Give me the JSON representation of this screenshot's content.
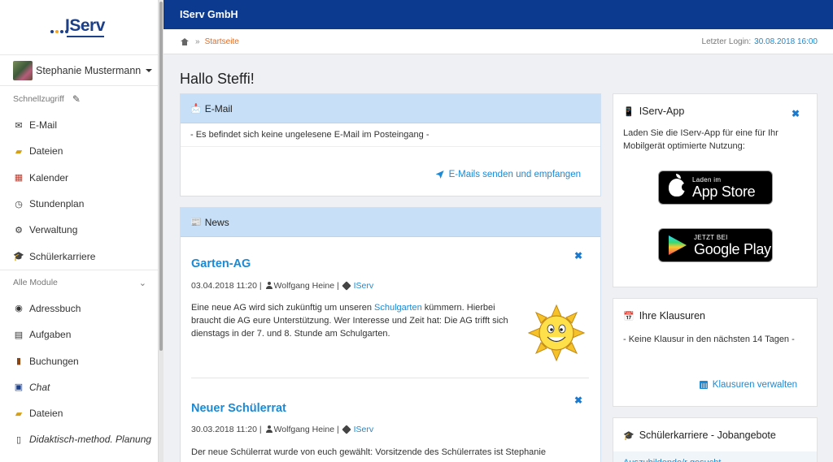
{
  "brand": {
    "logo_text": "IServ",
    "dot_colors": [
      "#1c3f8a",
      "#f5a623",
      "#1c3f8a",
      "#1c3f8a"
    ],
    "company": "IServ GmbH",
    "top_bar_color": "#0b3a8f",
    "link_color": "#1a8ad6",
    "breadcrumb_color": "#e46b1f"
  },
  "user": {
    "name": "Stephanie Mustermann"
  },
  "sidebar": {
    "quick_title": "Schnellzugriff",
    "quick_items": [
      {
        "label": "E-Mail",
        "icon": "envelope-icon"
      },
      {
        "label": "Dateien",
        "icon": "folder-icon"
      },
      {
        "label": "Kalender",
        "icon": "calendar-icon"
      },
      {
        "label": "Stundenplan",
        "icon": "clock-icon"
      },
      {
        "label": "Verwaltung",
        "icon": "gear-icon"
      },
      {
        "label": "Schülerkarriere",
        "icon": "graduation-cap-icon"
      }
    ],
    "all_title": "Alle Module",
    "all_items": [
      {
        "label": "Adressbuch",
        "icon": "address-book-icon"
      },
      {
        "label": "Aufgaben",
        "icon": "clipboard-icon"
      },
      {
        "label": "Buchungen",
        "icon": "book-icon"
      },
      {
        "label": "Chat",
        "icon": "chat-icon"
      },
      {
        "label": "Dateien",
        "icon": "folder-icon"
      },
      {
        "label": "Didaktisch-method. Planung",
        "icon": "document-icon"
      }
    ]
  },
  "breadcrumb": {
    "current": "Startseite",
    "separator": "»",
    "last_login_label": "Letzter Login:",
    "last_login_value": "30.08.2018 16:00"
  },
  "greeting": "Hallo Steffi!",
  "mail": {
    "title": "E-Mail",
    "empty_text": "- Es befindet sich keine ungelesene E-Mail im Posteingang -",
    "link": "E-Mails senden und empfangen"
  },
  "news": {
    "title": "News",
    "items": [
      {
        "title": "Garten-AG",
        "date": "03.04.2018 11:20",
        "author": "Wolfgang Heine",
        "tag": "IServ",
        "text_before": "Eine neue AG wird sich zukünftig um unseren ",
        "text_link": "Schulgarten",
        "text_after": " kümmern. Hierbei braucht die AG eure Unterstützung. Wer Interesse und Zeit hat: Die AG trifft sich dienstags in der 7. und 8. Stunde am Schulgarten."
      },
      {
        "title": "Neuer Schülerrat",
        "date": "30.03.2018 11:20",
        "author": "Wolfgang Heine",
        "tag": "IServ",
        "text": "Der neue Schülerrat wurde von euch gewählt: Vorsitzende des Schülerrates ist Stephanie"
      }
    ],
    "sep": "|"
  },
  "app": {
    "title": "IServ-App",
    "text": "Laden Sie die IServ-App für eine für Ihr Mobilgerät optimierte Nutzung:",
    "appstore_small": "Laden im",
    "appstore_big": "App Store",
    "play_small": "JETZT BEI",
    "play_big": "Google Play"
  },
  "klausuren": {
    "title": "Ihre Klausuren",
    "empty_text": "- Keine Klausur in den nächsten 14 Tagen -",
    "link": "Klausuren verwalten"
  },
  "jobs": {
    "title": "Schülerkarriere - Jobangebote",
    "sub_link": "Auszubildende/r gesucht"
  }
}
